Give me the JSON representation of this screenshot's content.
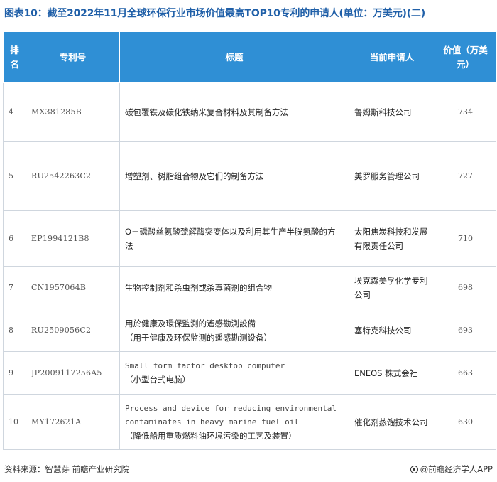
{
  "title": "图表10：截至2022年11月全球环保行业市场价值最高TOP10专利的申请人(单位：万美元)(二)",
  "table": {
    "headers": {
      "rank": "排名",
      "patent_no": "专利号",
      "title": "标题",
      "applicant": "当前申请人",
      "value": "价值（万美元）"
    },
    "rows": [
      {
        "rank": "4",
        "patent_no": "MX381285B",
        "title_en": "",
        "title_cn": "碳包覆铁及碳化铁纳米复合材料及其制备方法",
        "applicant": "鲁姆斯科技公司",
        "value": "734"
      },
      {
        "rank": "5",
        "patent_no": "RU2542263C2",
        "title_en": "",
        "title_cn": "增塑剂、树脂组合物及它们的制备方法",
        "applicant": "美罗服务管理公司",
        "value": "727"
      },
      {
        "rank": "6",
        "patent_no": "EP1994121B8",
        "title_en": "",
        "title_cn": "O－磷酸丝氨酸巯解酶突变体以及利用其生产半胱氨酸的方法",
        "applicant": "太阳焦炭科技和发展有限责任公司",
        "value": "710"
      },
      {
        "rank": "7",
        "patent_no": "CN1957064B",
        "title_en": "",
        "title_cn": "生物控制剂和杀虫剂或杀真菌剂的组合物",
        "applicant": "埃克森美孚化学专利公司",
        "value": "698"
      },
      {
        "rank": "8",
        "patent_no": "RU2509056C2",
        "title_en": "用於健康及環保監測的遙感勘測設備",
        "title_cn": "（用于健康及环保监测的遥感勘测设备）",
        "applicant": "塞特克科技公司",
        "value": "693"
      },
      {
        "rank": "9",
        "patent_no": "JP2009117256A5",
        "title_en": "Small form factor desktop computer",
        "title_cn": "（小型台式电脑）",
        "applicant": "ENEOS 株式会社",
        "value": "663"
      },
      {
        "rank": "10",
        "patent_no": "MY172621A",
        "title_en": "Process and device for reducing environmental contaminates in heavy marine fuel oil",
        "title_cn": "（降低船用重质燃料油环境污染的工艺及装置）",
        "applicant": "催化剂蒸馏技术公司",
        "value": "630"
      }
    ]
  },
  "footer": {
    "source": "资料来源：智慧芽 前瞻产业研究院",
    "brand": "@前瞻经济学人APP",
    "brand_icon": "circle-logo-icon"
  }
}
